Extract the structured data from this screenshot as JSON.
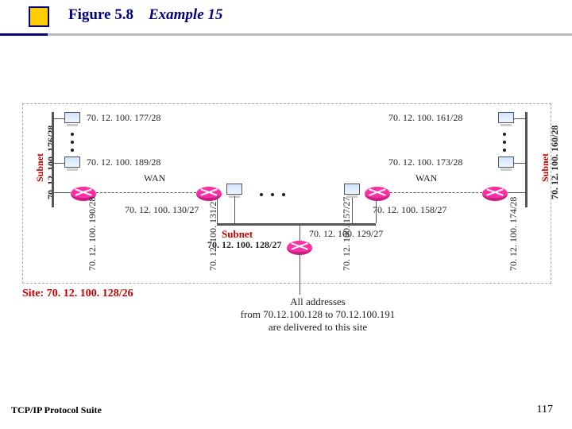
{
  "title": {
    "fig": "Figure 5.8",
    "name": "Example 15"
  },
  "site_label": "Site: 70. 12. 100. 128/26",
  "caption_l1": "All addresses",
  "caption_l2": "from 70.12.100.128 to 70.12.100.191",
  "caption_l3": "are delivered to this site",
  "footer": {
    "left": "TCP/IP Protocol Suite",
    "page": "117"
  },
  "subnet_left": {
    "label": "Subnet",
    "addr": "70. 12. 100. 176/28"
  },
  "subnet_right": {
    "label": "Subnet",
    "addr": "70. 12. 100. 160/28"
  },
  "subnet_mid": {
    "label": "Subnet",
    "addr": "70. 12. 100. 128/27"
  },
  "hosts": {
    "left_top": "70. 12. 100. 177/28",
    "left_bot": "70. 12. 100. 189/28",
    "right_top": "70. 12. 100. 161/28",
    "right_bot": "70. 12. 100. 173/28"
  },
  "wan": "WAN",
  "router_left_ip": "70. 12. 100. 130/27",
  "router_right_ip": "70. 12. 100. 158/27",
  "router_center_ip": "70. 12. 100. 129/27",
  "if_left_out": "70. 12. 100. 190/28",
  "if_left_in": "70. 12. 100. 131/27",
  "if_right_in": "70. 12. 100. 157/27",
  "if_right_out": "70. 12. 100. 174/28"
}
